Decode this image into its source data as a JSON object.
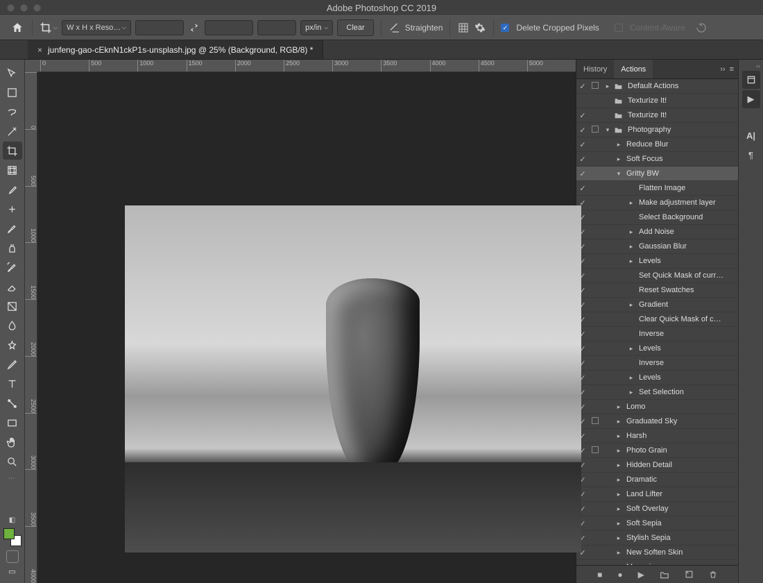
{
  "app_title": "Adobe Photoshop CC 2019",
  "options_bar": {
    "preset_label": "W x H x Reso…",
    "unit": "px/in",
    "clear": "Clear",
    "straighten": "Straighten",
    "delete_cropped": "Delete Cropped Pixels",
    "content_aware": "Content-Aware"
  },
  "document_tab": {
    "filename": "junfeng-gao-cEknN1ckP1s-unsplash.jpg",
    "suffix": "@ 25% (Background, RGB/8) *"
  },
  "ruler_h": [
    "0",
    "500",
    "1000",
    "1500",
    "2000",
    "2500",
    "3000",
    "3500",
    "4000",
    "4500",
    "5000"
  ],
  "ruler_v": [
    "0",
    "500",
    "1000",
    "1500",
    "2000",
    "2500",
    "3000",
    "3500",
    "4000"
  ],
  "panel_tabs": {
    "history": "History",
    "actions": "Actions"
  },
  "actions": [
    {
      "check": true,
      "dlg": true,
      "chevron": "▸",
      "folder": true,
      "label": "Default Actions",
      "depth": 0
    },
    {
      "check": false,
      "dlg": false,
      "chevron": "",
      "folder": true,
      "label": "Texturize It!",
      "depth": 0
    },
    {
      "check": true,
      "dlg": false,
      "chevron": "",
      "folder": true,
      "label": "Texturize It!",
      "depth": 0
    },
    {
      "check": true,
      "dlg": true,
      "chevron": "▾",
      "folder": true,
      "label": "Photography",
      "depth": 0
    },
    {
      "check": true,
      "dlg": false,
      "chevron": "▸",
      "folder": false,
      "label": "Reduce Blur",
      "depth": 1
    },
    {
      "check": true,
      "dlg": false,
      "chevron": "▸",
      "folder": false,
      "label": "Soft Focus",
      "depth": 1
    },
    {
      "check": true,
      "dlg": false,
      "chevron": "▾",
      "folder": false,
      "label": "Gritty BW",
      "depth": 1,
      "selected": true
    },
    {
      "check": true,
      "dlg": false,
      "chevron": "",
      "folder": false,
      "label": "Flatten Image",
      "depth": 2
    },
    {
      "check": true,
      "dlg": false,
      "chevron": "▸",
      "folder": false,
      "label": "Make adjustment layer",
      "depth": 2
    },
    {
      "check": true,
      "dlg": false,
      "chevron": "",
      "folder": false,
      "label": "Select Background",
      "depth": 2
    },
    {
      "check": true,
      "dlg": false,
      "chevron": "▸",
      "folder": false,
      "label": "Add Noise",
      "depth": 2
    },
    {
      "check": true,
      "dlg": false,
      "chevron": "▸",
      "folder": false,
      "label": "Gaussian Blur",
      "depth": 2
    },
    {
      "check": true,
      "dlg": false,
      "chevron": "▸",
      "folder": false,
      "label": "Levels",
      "depth": 2
    },
    {
      "check": true,
      "dlg": false,
      "chevron": "",
      "folder": false,
      "label": "Set Quick Mask of curr…",
      "depth": 2
    },
    {
      "check": true,
      "dlg": false,
      "chevron": "",
      "folder": false,
      "label": "Reset Swatches",
      "depth": 2
    },
    {
      "check": true,
      "dlg": false,
      "chevron": "▸",
      "folder": false,
      "label": "Gradient",
      "depth": 2
    },
    {
      "check": true,
      "dlg": false,
      "chevron": "",
      "folder": false,
      "label": "Clear Quick Mask of c…",
      "depth": 2
    },
    {
      "check": true,
      "dlg": false,
      "chevron": "",
      "folder": false,
      "label": "Inverse",
      "depth": 2
    },
    {
      "check": true,
      "dlg": false,
      "chevron": "▸",
      "folder": false,
      "label": "Levels",
      "depth": 2
    },
    {
      "check": true,
      "dlg": false,
      "chevron": "",
      "folder": false,
      "label": "Inverse",
      "depth": 2
    },
    {
      "check": true,
      "dlg": false,
      "chevron": "▸",
      "folder": false,
      "label": "Levels",
      "depth": 2
    },
    {
      "check": true,
      "dlg": false,
      "chevron": "▸",
      "folder": false,
      "label": "Set Selection",
      "depth": 2
    },
    {
      "check": true,
      "dlg": false,
      "chevron": "▸",
      "folder": false,
      "label": "Lomo",
      "depth": 1
    },
    {
      "check": true,
      "dlg": true,
      "chevron": "▸",
      "folder": false,
      "label": "Graduated Sky",
      "depth": 1
    },
    {
      "check": true,
      "dlg": false,
      "chevron": "▸",
      "folder": false,
      "label": "Harsh",
      "depth": 1
    },
    {
      "check": true,
      "dlg": true,
      "chevron": "▸",
      "folder": false,
      "label": "Photo Grain",
      "depth": 1
    },
    {
      "check": true,
      "dlg": false,
      "chevron": "▸",
      "folder": false,
      "label": "Hidden Detail",
      "depth": 1
    },
    {
      "check": true,
      "dlg": false,
      "chevron": "▸",
      "folder": false,
      "label": "Dramatic",
      "depth": 1
    },
    {
      "check": true,
      "dlg": false,
      "chevron": "▸",
      "folder": false,
      "label": "Land Lifter",
      "depth": 1
    },
    {
      "check": true,
      "dlg": false,
      "chevron": "▸",
      "folder": false,
      "label": "Soft Overlay",
      "depth": 1
    },
    {
      "check": true,
      "dlg": false,
      "chevron": "▸",
      "folder": false,
      "label": "Soft Sepia",
      "depth": 1
    },
    {
      "check": true,
      "dlg": false,
      "chevron": "▸",
      "folder": false,
      "label": "Stylish Sepia",
      "depth": 1
    },
    {
      "check": true,
      "dlg": false,
      "chevron": "▸",
      "folder": false,
      "label": "New Soften Skin",
      "depth": 1
    },
    {
      "check": false,
      "dlg": false,
      "chevron": "▸",
      "folder": false,
      "label": "Magazine",
      "depth": 1
    }
  ],
  "tools": [
    "move",
    "marquee",
    "lasso",
    "magic-wand",
    "crop",
    "frame",
    "eyedropper",
    "healing",
    "brush",
    "clone",
    "history-brush",
    "eraser",
    "gradient",
    "blur",
    "dodge",
    "pen",
    "type",
    "path",
    "rectangle",
    "hand",
    "zoom"
  ]
}
